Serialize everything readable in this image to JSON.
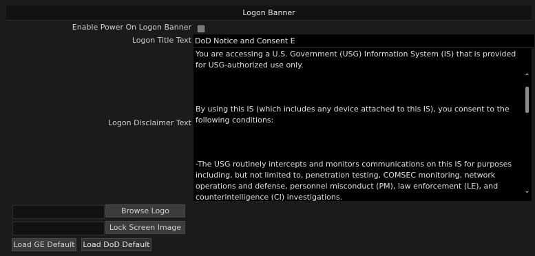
{
  "dialog": {
    "title": "Logon Banner"
  },
  "fields": {
    "enable_banner_label": "Enable Power On Logon Banner",
    "title_text_label": "Logon Title Text",
    "title_text_value": "DoD Notice and Consent E",
    "disclaimer_label": "Logon Disclaimer Text"
  },
  "disclaimer": {
    "paragraphs": [
      "You are accessing a U.S. Government (USG) Information System (IS) that is provided for USG-authorized use only.",
      "By using this IS (which includes any device attached to this IS), you consent to the following conditions:",
      "-The USG routinely intercepts and monitors communications on this IS for purposes including, but not limited to, penetration testing, COMSEC monitoring, network operations and defense, personnel misconduct (PM), law enforcement (LE), and counterintelligence (CI) investigations."
    ]
  },
  "buttons": {
    "browse_logo": "Browse Logo",
    "lock_screen_image": "Lock Screen Image",
    "load_ge_default": "Load GE Default",
    "load_dod_default": "Load DoD Default"
  },
  "icons": {
    "scroll_up": "chevron-up-icon",
    "scroll_down": "chevron-down-icon"
  },
  "state": {
    "enable_banner_checked": false
  }
}
